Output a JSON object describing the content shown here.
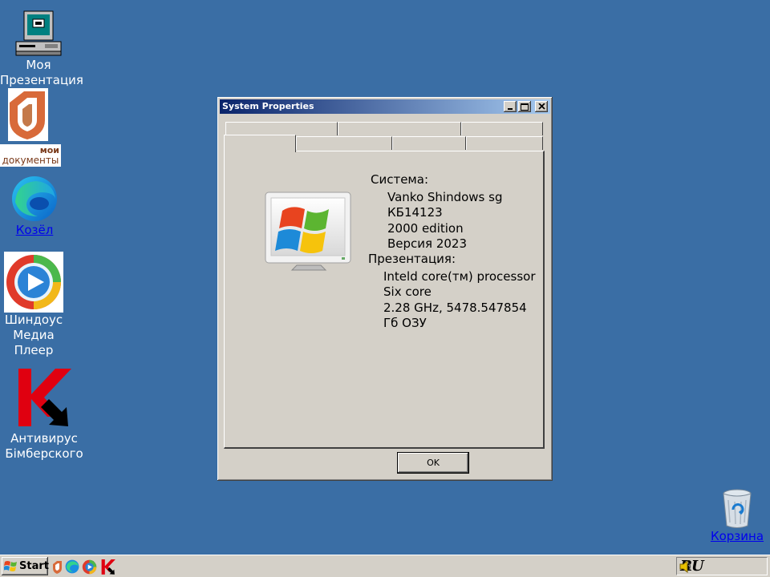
{
  "desktop": {
    "icons": [
      {
        "label": "Моя\nПрезентация"
      },
      {
        "label": "Козёл"
      },
      {
        "label": "Шиндоус\nМедиа\nПлеер"
      },
      {
        "label": "Антивирус\nБімберского"
      },
      {
        "label": "Корзина"
      }
    ],
    "mydocs_logo_text_top": "мои",
    "mydocs_logo_text_bottom": "документы"
  },
  "window": {
    "title": "System Properties",
    "system_heading": "Система:",
    "system_lines": [
      "Vanko Shindows sg",
      "КБ14123",
      "2000 edition",
      "Версия 2023"
    ],
    "presentation_heading": "Презентация:",
    "presentation_lines": [
      "Inteld core(тм) processor",
      "Six core",
      "2.28 GHz, 5478.547854",
      "Гб ОЗУ"
    ],
    "ok_label": "OK"
  },
  "taskbar": {
    "start_label": "Start",
    "language": "RU"
  }
}
